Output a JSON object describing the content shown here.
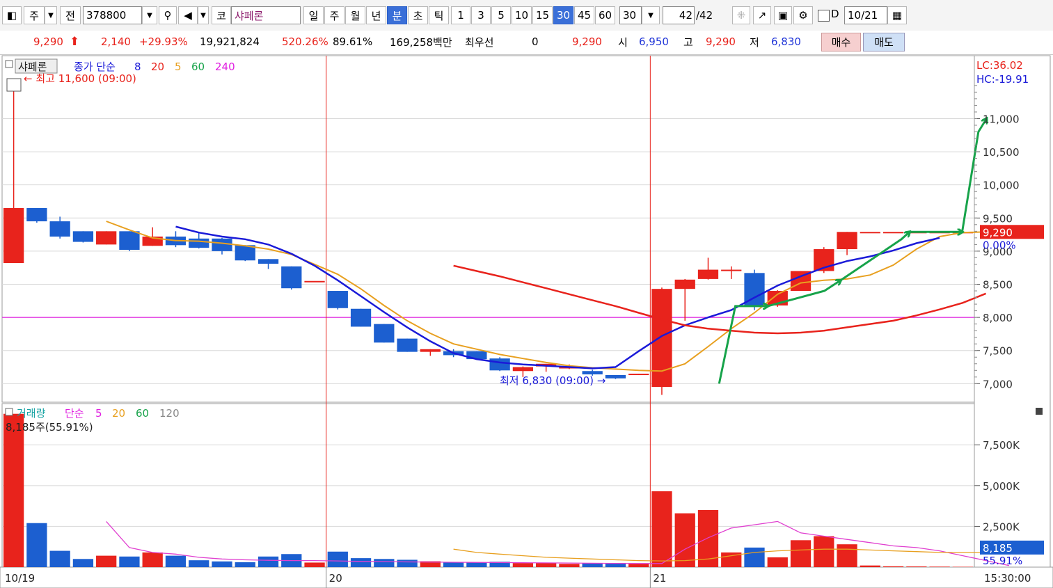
{
  "toolbar": {
    "market_code": "주",
    "prev_label": "전",
    "code": "378800",
    "exchange": "코",
    "stock_name": "샤페론",
    "periods": [
      "일",
      "주",
      "월",
      "년",
      "분",
      "초",
      "틱"
    ],
    "active_period": "분",
    "intervals": [
      "1",
      "3",
      "5",
      "10",
      "15",
      "30",
      "45",
      "60"
    ],
    "active_interval": "30",
    "count_select": "30",
    "page_current": "42",
    "page_total": "/42",
    "d_label": "D",
    "date": "10/21"
  },
  "quote": {
    "price": "9,290",
    "change": "2,140",
    "change_pct": "+29.93%",
    "volume": "19,921,824",
    "vol_ratio": "520.26%",
    "turnover": "89.61%",
    "amount": "169,258백만",
    "best_label": "최우선",
    "best_qty": "0",
    "best_price": "9,290",
    "open_label": "시",
    "open": "6,950",
    "high_label": "고",
    "high": "9,290",
    "low_label": "저",
    "low": "6,830",
    "buy_label": "매수",
    "sell_label": "매도"
  },
  "price_panel": {
    "name": "샤페론",
    "ma_label": "종가 단순",
    "ma_periods": [
      "8",
      "20",
      "5",
      "60",
      "240"
    ],
    "max_label": "최고 11,600 (09:00)",
    "min_label": "최저 6,830 (09:00)",
    "lc": "LC:36.02",
    "hc": "HC:-19.91",
    "current_price": "9,290",
    "current_pct": "0.00%"
  },
  "volume_panel": {
    "label": "거래량",
    "ma_label": "단순",
    "ma_periods": [
      "5",
      "20",
      "60",
      "120"
    ],
    "max_label": "8,185주(55.91%)",
    "current": "8,185",
    "current_pct": "55.91%"
  },
  "chart_data": {
    "type": "candlestick",
    "price_ylim": [
      6720,
      11950
    ],
    "price_ticks": [
      7000,
      7500,
      8000,
      8500,
      9000,
      9500,
      10000,
      10500,
      11000
    ],
    "price_tick_labels": [
      "7,000",
      "7,500",
      "8,000",
      "8,500",
      "9,000",
      "9,500",
      "10,000",
      "10,500",
      "11,000"
    ],
    "reference_line": 8000,
    "volume_ylim": [
      0,
      9600
    ],
    "volume_ticks": [
      2500,
      5000,
      7500
    ],
    "volume_tick_labels": [
      "2,500K",
      "5,000K",
      "7,500K"
    ],
    "date_labels": [
      {
        "index": 0,
        "label": "10/19"
      },
      {
        "index": 14,
        "label": "20"
      },
      {
        "index": 28,
        "label": "21"
      }
    ],
    "time_label": "15:30:00",
    "candles": [
      {
        "o": 8820,
        "h": 11600,
        "l": 8820,
        "c": 9650,
        "v": 9400
      },
      {
        "o": 9650,
        "h": 9650,
        "l": 9430,
        "c": 9450,
        "v": 2700
      },
      {
        "o": 9450,
        "h": 9520,
        "l": 9190,
        "c": 9220,
        "v": 1000
      },
      {
        "o": 9300,
        "h": 9300,
        "l": 9130,
        "c": 9140,
        "v": 500
      },
      {
        "o": 9100,
        "h": 9300,
        "l": 9100,
        "c": 9300,
        "v": 700
      },
      {
        "o": 9300,
        "h": 9300,
        "l": 9000,
        "c": 9020,
        "v": 650
      },
      {
        "o": 9080,
        "h": 9360,
        "l": 9080,
        "c": 9220,
        "v": 900
      },
      {
        "o": 9220,
        "h": 9300,
        "l": 9060,
        "c": 9090,
        "v": 700
      },
      {
        "o": 9190,
        "h": 9290,
        "l": 9040,
        "c": 9050,
        "v": 420
      },
      {
        "o": 9190,
        "h": 9200,
        "l": 8950,
        "c": 9000,
        "v": 350
      },
      {
        "o": 9090,
        "h": 9090,
        "l": 8850,
        "c": 8860,
        "v": 300
      },
      {
        "o": 8880,
        "h": 8880,
        "l": 8730,
        "c": 8810,
        "v": 650
      },
      {
        "o": 8770,
        "h": 8770,
        "l": 8420,
        "c": 8440,
        "v": 800
      },
      {
        "o": 8550,
        "h": 8550,
        "l": 8550,
        "c": 8550,
        "v": 280
      },
      {
        "o": 8400,
        "h": 8400,
        "l": 8120,
        "c": 8140,
        "v": 950
      },
      {
        "o": 8130,
        "h": 8130,
        "l": 7860,
        "c": 7860,
        "v": 550
      },
      {
        "o": 7900,
        "h": 7900,
        "l": 7620,
        "c": 7620,
        "v": 500
      },
      {
        "o": 7680,
        "h": 7680,
        "l": 7480,
        "c": 7480,
        "v": 450
      },
      {
        "o": 7480,
        "h": 7520,
        "l": 7420,
        "c": 7520,
        "v": 360
      },
      {
        "o": 7490,
        "h": 7520,
        "l": 7400,
        "c": 7430,
        "v": 300
      },
      {
        "o": 7490,
        "h": 7490,
        "l": 7360,
        "c": 7370,
        "v": 300
      },
      {
        "o": 7380,
        "h": 7400,
        "l": 7190,
        "c": 7200,
        "v": 330
      },
      {
        "o": 7190,
        "h": 7260,
        "l": 7100,
        "c": 7250,
        "v": 250
      },
      {
        "o": 7260,
        "h": 7300,
        "l": 7180,
        "c": 7300,
        "v": 250
      },
      {
        "o": 7240,
        "h": 7290,
        "l": 7220,
        "c": 7250,
        "v": 200
      },
      {
        "o": 7190,
        "h": 7210,
        "l": 7120,
        "c": 7140,
        "v": 250
      },
      {
        "o": 7130,
        "h": 7130,
        "l": 7070,
        "c": 7080,
        "v": 250
      },
      {
        "o": 7150,
        "h": 7150,
        "l": 7130,
        "c": 7150,
        "v": 200
      },
      {
        "o": 6950,
        "h": 8450,
        "l": 6830,
        "c": 8430,
        "v": 4650
      },
      {
        "o": 8430,
        "h": 8580,
        "l": 7950,
        "c": 8570,
        "v": 3300
      },
      {
        "o": 8580,
        "h": 8900,
        "l": 8570,
        "c": 8720,
        "v": 3500
      },
      {
        "o": 8720,
        "h": 8770,
        "l": 8580,
        "c": 8720,
        "v": 900
      },
      {
        "o": 8670,
        "h": 8720,
        "l": 8110,
        "c": 8170,
        "v": 1200
      },
      {
        "o": 8180,
        "h": 8410,
        "l": 8160,
        "c": 8400,
        "v": 600
      },
      {
        "o": 8400,
        "h": 8700,
        "l": 8400,
        "c": 8700,
        "v": 1650
      },
      {
        "o": 8700,
        "h": 9060,
        "l": 8670,
        "c": 9030,
        "v": 1900
      },
      {
        "o": 9030,
        "h": 9290,
        "l": 8940,
        "c": 9290,
        "v": 1400
      },
      {
        "o": 9290,
        "h": 9290,
        "l": 9290,
        "c": 9290,
        "v": 100
      },
      {
        "o": 9290,
        "h": 9290,
        "l": 9290,
        "c": 9290,
        "v": 50
      },
      {
        "o": 9290,
        "h": 9290,
        "l": 9290,
        "c": 9290,
        "v": 40
      },
      {
        "o": 9290,
        "h": 9290,
        "l": 9290,
        "c": 9290,
        "v": 30
      },
      {
        "o": 9290,
        "h": 9290,
        "l": 9290,
        "c": 9290,
        "v": 20
      }
    ],
    "series": [
      {
        "name": "5",
        "color": "#e8a020",
        "start": 4,
        "values": [
          9450,
          9320,
          9200,
          9160,
          9150,
          9120,
          9080,
          9030,
          8950,
          8800,
          8650,
          8430,
          8180,
          7950,
          7760,
          7600,
          7520,
          7440,
          7380,
          7320,
          7270,
          7240,
          7220,
          7200,
          7190,
          7300,
          7560,
          7830,
          8070,
          8350,
          8520,
          8560,
          8580,
          8640,
          8790,
          9030,
          9220,
          9280,
          9290,
          9290
        ]
      },
      {
        "name": "8",
        "color": "#1a1ad8",
        "start": 7,
        "values": [
          9370,
          9280,
          9220,
          9180,
          9100,
          8960,
          8780,
          8560,
          8320,
          8080,
          7850,
          7640,
          7460,
          7370,
          7320,
          7290,
          7270,
          7250,
          7230,
          7250,
          7490,
          7720,
          7880,
          8000,
          8110,
          8300,
          8480,
          8620,
          8750,
          8850,
          8920,
          9010,
          9120,
          9200
        ]
      },
      {
        "name": "20",
        "color": "#e8231c",
        "start": 19,
        "values": [
          8780,
          8700,
          8620,
          8530,
          8440,
          8350,
          8260,
          8170,
          8070,
          7970,
          7880,
          7830,
          7800,
          7770,
          7760,
          7770,
          7800,
          7850,
          7900,
          7950,
          8030,
          8120,
          8220,
          8360
        ]
      }
    ],
    "volume_ma": [
      {
        "name": "5",
        "color": "#e040d0",
        "start": 4,
        "values": [
          2800,
          1200,
          900,
          800,
          600,
          500,
          450,
          420,
          400,
          400,
          380,
          350,
          340,
          320,
          310,
          300,
          290,
          280,
          270,
          260,
          250,
          240,
          230,
          220,
          220,
          1100,
          1800,
          2400,
          2600,
          2800,
          2100,
          1900,
          1700,
          1500,
          1300,
          1200,
          1000,
          700,
          400,
          100
        ]
      },
      {
        "name": "20",
        "color": "#e8a020",
        "start": 19,
        "values": [
          1100,
          900,
          800,
          700,
          600,
          550,
          500,
          450,
          400,
          380,
          400,
          500,
          700,
          900,
          1000,
          1050,
          1100,
          1100,
          1050,
          1000,
          950,
          900,
          900,
          900
        ]
      }
    ],
    "annotations": [
      {
        "type": "arrow",
        "color": "#17a34a",
        "points": [
          [
            8.85,
            7000
          ],
          [
            9.05,
            8170
          ],
          [
            9.45,
            8170
          ]
        ]
      },
      {
        "type": "arrow",
        "color": "#17a34a",
        "points": [
          [
            9.45,
            8170
          ],
          [
            10.15,
            8400
          ],
          [
            10.35,
            8560
          ]
        ]
      },
      {
        "type": "arrow",
        "color": "#17a34a",
        "points": [
          [
            10.35,
            8560
          ],
          [
            11.1,
            9180
          ],
          [
            11.2,
            9290
          ]
        ]
      },
      {
        "type": "arrow",
        "color": "#17a34a",
        "points": [
          [
            11.2,
            9290
          ],
          [
            11.75,
            9290
          ],
          [
            11.85,
            9290
          ]
        ]
      },
      {
        "type": "arrow",
        "color": "#17a34a",
        "points": [
          [
            11.85,
            9290
          ],
          [
            12.05,
            10800
          ],
          [
            12.15,
            11000
          ]
        ]
      }
    ]
  }
}
